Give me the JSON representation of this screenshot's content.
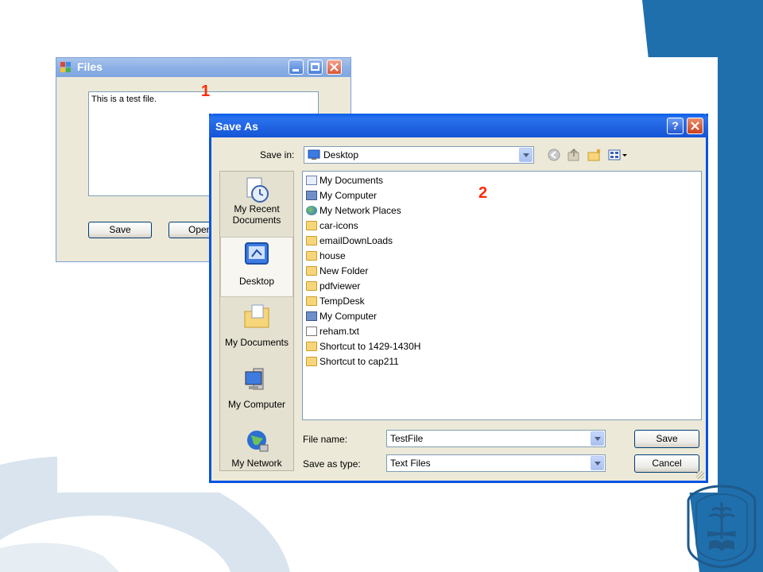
{
  "colors": {
    "accent_blue": "#0054e3",
    "slide_blue": "#1f6fad",
    "marker_red": "#ff2a00"
  },
  "markers": {
    "one": "1",
    "two": "2"
  },
  "files_window": {
    "title": "Files",
    "textbox_value": "This is a test file.",
    "save_label": "Save",
    "open_label": "Open"
  },
  "save_as": {
    "title": "Save As",
    "help_label": "?",
    "save_in_label": "Save in:",
    "save_in_value": "Desktop",
    "places": [
      {
        "label": "My Recent Documents",
        "icon": "recent-documents-icon"
      },
      {
        "label": "Desktop",
        "icon": "desktop-icon"
      },
      {
        "label": "My Documents",
        "icon": "my-documents-icon"
      },
      {
        "label": "My Computer",
        "icon": "my-computer-icon"
      },
      {
        "label": "My Network",
        "icon": "my-network-icon"
      }
    ],
    "files": [
      {
        "name": "My Documents",
        "icon": "my-documents-icon"
      },
      {
        "name": "My Computer",
        "icon": "my-computer-icon"
      },
      {
        "name": "My Network Places",
        "icon": "network-places-icon"
      },
      {
        "name": "car-icons",
        "icon": "folder-icon"
      },
      {
        "name": "emailDownLoads",
        "icon": "folder-icon"
      },
      {
        "name": "house",
        "icon": "folder-icon"
      },
      {
        "name": "New Folder",
        "icon": "folder-icon"
      },
      {
        "name": "pdfviewer",
        "icon": "folder-icon"
      },
      {
        "name": "TempDesk",
        "icon": "folder-icon"
      },
      {
        "name": "My Computer",
        "icon": "computer-shortcut-icon"
      },
      {
        "name": "reham.txt",
        "icon": "text-file-icon"
      },
      {
        "name": "Shortcut to 1429-1430H",
        "icon": "folder-shortcut-icon"
      },
      {
        "name": "Shortcut to cap211",
        "icon": "folder-shortcut-icon"
      }
    ],
    "file_name_label": "File name:",
    "file_name_value": "TestFile",
    "save_type_label": "Save as type:",
    "save_type_value": "Text Files",
    "save_button": "Save",
    "cancel_button": "Cancel"
  }
}
